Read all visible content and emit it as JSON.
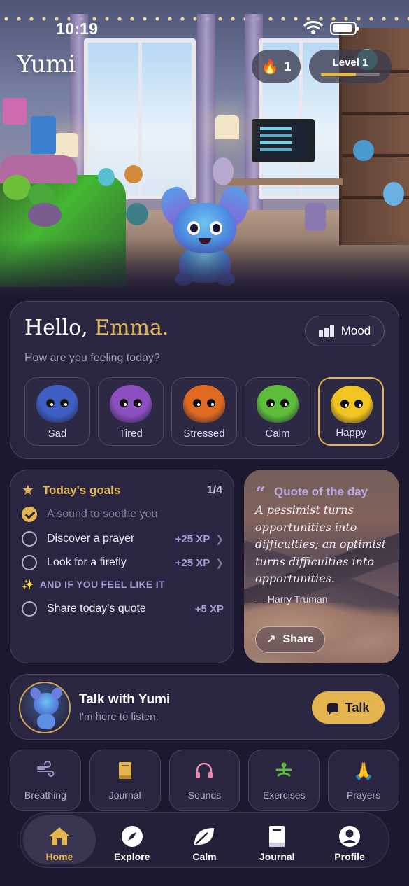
{
  "status_bar": {
    "time": "10:19"
  },
  "app": {
    "title": "Yumi"
  },
  "header": {
    "streak_count": "1",
    "level_label": "Level 1",
    "level_progress": 0.6,
    "accent": "#e4b54f"
  },
  "hello_card": {
    "greeting": "Hello,",
    "name": "Emma.",
    "mood_button": "Mood",
    "question": "How are you feeling today?",
    "moods": [
      {
        "label": "Sad",
        "color": "#3f5fc4",
        "selected": false
      },
      {
        "label": "Tired",
        "color": "#8b4fc0",
        "selected": false
      },
      {
        "label": "Stressed",
        "color": "#e06a22",
        "selected": false
      },
      {
        "label": "Calm",
        "color": "#5dbd3a",
        "selected": false
      },
      {
        "label": "Happy",
        "color": "#f2c41f",
        "selected": true
      }
    ]
  },
  "goals": {
    "title": "Today's goals",
    "count": "1/4",
    "items": [
      {
        "label": "A sound to soothe you",
        "done": true,
        "xp": ""
      },
      {
        "label": "Discover a prayer",
        "done": false,
        "xp": "+25 XP"
      },
      {
        "label": "Look for a firefly",
        "done": false,
        "xp": "+25 XP"
      }
    ],
    "extra_heading": "AND IF YOU FEEL LIKE IT",
    "extra_items": [
      {
        "label": "Share today's quote",
        "done": false,
        "xp": "+5 XP"
      }
    ]
  },
  "quote": {
    "title": "Quote of the day",
    "text": "A pessimist turns opportunities into difficulties; an optimist turns difficulties into opportunities.",
    "author": "— Harry Truman",
    "share_label": "Share"
  },
  "talk": {
    "title": "Talk with Yumi",
    "subtitle": "I'm here to listen.",
    "button": "Talk"
  },
  "tools": [
    {
      "label": "Breathing",
      "icon": "wind-icon",
      "color": "#9f95c8"
    },
    {
      "label": "Journal",
      "icon": "book-icon",
      "color": "#e4b54f"
    },
    {
      "label": "Sounds",
      "icon": "headphones-icon",
      "color": "#e58aa8"
    },
    {
      "label": "Exercises",
      "icon": "meditation-icon",
      "color": "#5dbd3a"
    },
    {
      "label": "Prayers",
      "icon": "praying-hands-icon",
      "color": "#ffffff"
    }
  ],
  "nav": [
    {
      "label": "Home",
      "icon": "home-icon",
      "active": true
    },
    {
      "label": "Explore",
      "icon": "compass-icon",
      "active": false
    },
    {
      "label": "Calm",
      "icon": "leaf-icon",
      "active": false
    },
    {
      "label": "Journal",
      "icon": "book-icon",
      "active": false
    },
    {
      "label": "Profile",
      "icon": "profile-icon",
      "active": false
    }
  ]
}
